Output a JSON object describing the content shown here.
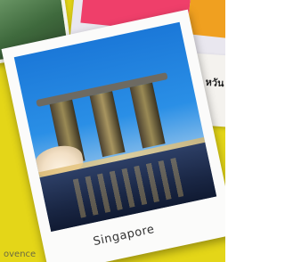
{
  "polaroid": {
    "caption": "Singapore"
  },
  "background": {
    "thai_text": "หวัน",
    "bottom_caption": "ovence"
  }
}
